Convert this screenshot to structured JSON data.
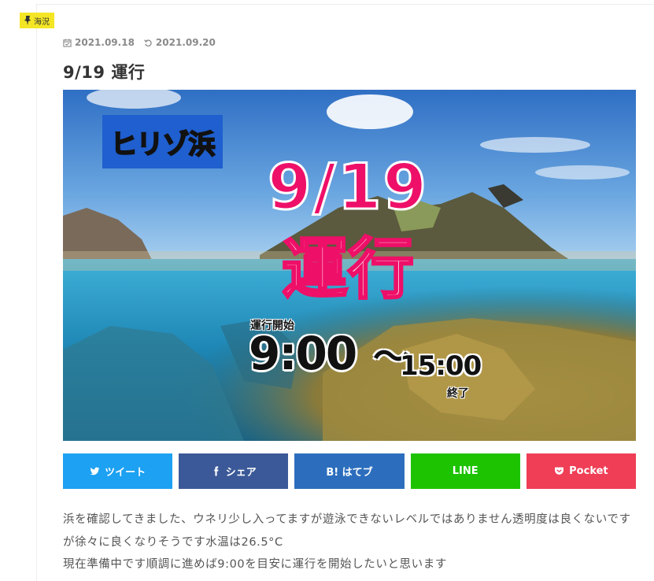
{
  "category": {
    "label": "海況",
    "icon": "pin-icon",
    "color": "#f4e625"
  },
  "meta": {
    "published": "2021.09.18",
    "updated": "2021.09.20",
    "published_icon": "calendar-check-icon",
    "updated_icon": "refresh-icon"
  },
  "post": {
    "title": "9/19 運行"
  },
  "hero": {
    "badge": "ヒリゾ浜",
    "date": "9/19",
    "status": "運行",
    "start_label": "運行開始",
    "start_time": "9:00",
    "separator": "〜",
    "end_time": "15:00",
    "end_label": "終了",
    "colors": {
      "badge": "#1f5fcf",
      "accent": "#ee0f68"
    }
  },
  "share": [
    {
      "label": "ツイート",
      "icon": "twitter-icon",
      "color": "#1da1f2"
    },
    {
      "label": "シェア",
      "icon": "facebook-icon",
      "color": "#3b5998"
    },
    {
      "label": "B! はてブ",
      "icon": "hatena-icon",
      "color": "#2c6ebd"
    },
    {
      "label": "LINE",
      "icon": "line-icon",
      "color": "#1dc300"
    },
    {
      "label": "Pocket",
      "icon": "pocket-icon",
      "color": "#ef3e56"
    }
  ],
  "content": {
    "paragraph_1": "浜を確認してきました、ウネリ少し入ってますが遊泳できないレベルではありません透明度は良くないですが徐々に良くなりそうです水温は26.5°C",
    "paragraph_2": "現在準備中です順調に進めば9:00を目安に運行を開始したいと思います"
  }
}
